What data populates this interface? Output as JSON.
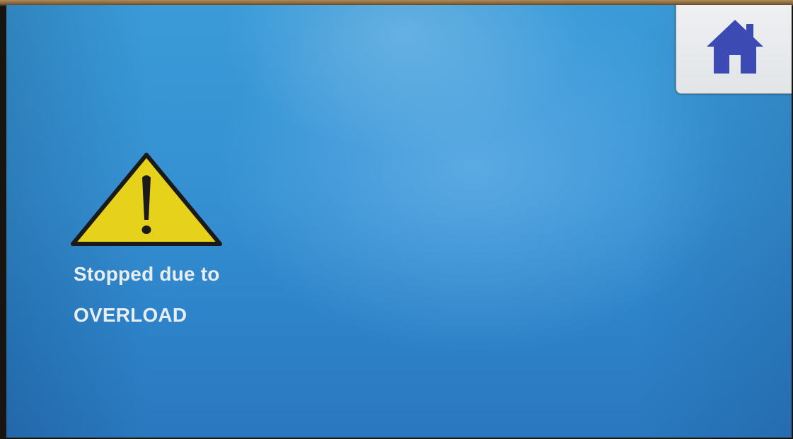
{
  "home_button": {
    "icon": "home-icon",
    "icon_color": "#3b4bb3"
  },
  "alert": {
    "icon": "warning-triangle-icon",
    "icon_color": "#e6d21a",
    "line1": "Stopped due to",
    "line2": "OVERLOAD"
  },
  "colors": {
    "screen_background": "#3590d2",
    "text": "#e9eef2"
  }
}
